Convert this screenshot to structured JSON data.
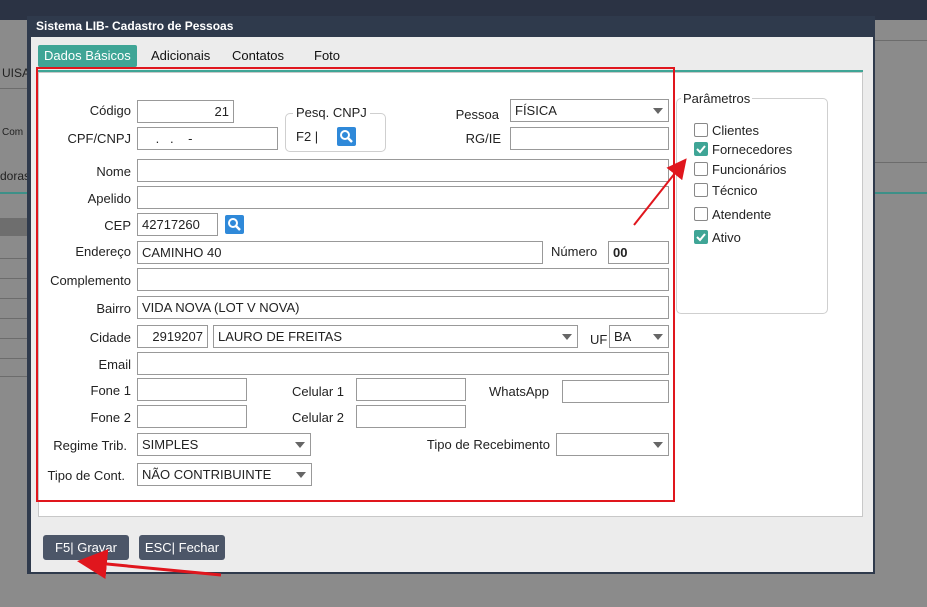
{
  "background": {
    "side_labels": [
      "UISA",
      "Com",
      "doras"
    ]
  },
  "dialog": {
    "title": "Sistema LIB- Cadastro de Pessoas",
    "tabs": [
      {
        "label": "Dados Básicos",
        "active": true
      },
      {
        "label": "Adicionais",
        "active": false
      },
      {
        "label": "Contatos",
        "active": false
      },
      {
        "label": "Foto",
        "active": false
      }
    ]
  },
  "form": {
    "codigo": {
      "label": "Código",
      "value": "21"
    },
    "pesq_cnpj": {
      "label": "Pesq. CNPJ",
      "hint": "F2 |"
    },
    "pessoa": {
      "label": "Pessoa",
      "value": "FÍSICA"
    },
    "cpf_cnpj": {
      "label": "CPF/CNPJ",
      "value": " .   .    -"
    },
    "rg_ie": {
      "label": "RG/IE",
      "value": ""
    },
    "nome": {
      "label": "Nome",
      "value": ""
    },
    "apelido": {
      "label": "Apelido",
      "value": ""
    },
    "cep": {
      "label": "CEP",
      "value": "42717260"
    },
    "endereco": {
      "label": "Endereço",
      "value": "CAMINHO 40"
    },
    "numero": {
      "label": "Número",
      "value": "00"
    },
    "complemento": {
      "label": "Complemento",
      "value": ""
    },
    "bairro": {
      "label": "Bairro",
      "value": "VIDA NOVA (LOT V NOVA)"
    },
    "cidade": {
      "label": "Cidade",
      "code": "2919207",
      "name": "LAURO DE FREITAS"
    },
    "uf": {
      "label": "UF",
      "value": "BA"
    },
    "email": {
      "label": "Email",
      "value": ""
    },
    "fone1": {
      "label": "Fone 1",
      "value": ""
    },
    "celular1": {
      "label": "Celular 1",
      "value": ""
    },
    "whatsapp": {
      "label": "WhatsApp",
      "value": ""
    },
    "fone2": {
      "label": "Fone 2",
      "value": ""
    },
    "celular2": {
      "label": "Celular 2",
      "value": ""
    },
    "regime_trib": {
      "label": "Regime Trib.",
      "value": "SIMPLES"
    },
    "tipo_recebimento": {
      "label": "Tipo de Recebimento",
      "value": ""
    },
    "tipo_cont": {
      "label": "Tipo de Cont.",
      "value": "NÃO CONTRIBUINTE"
    }
  },
  "parametros": {
    "title": "Parâmetros",
    "items": [
      {
        "label": "Clientes",
        "checked": false
      },
      {
        "label": "Fornecedores",
        "checked": true
      },
      {
        "label": "Funcionários",
        "checked": false
      },
      {
        "label": "Técnico",
        "checked": false
      },
      {
        "label": "Atendente",
        "checked": false
      },
      {
        "label": "Ativo",
        "checked": true
      }
    ]
  },
  "buttons": {
    "save": "F5| Gravar",
    "close": "ESC| Fechar"
  },
  "colors": {
    "accent": "#3fa596",
    "dialog_frame": "#2f3a4c",
    "annotation_red": "#e0161d",
    "button": "#4c5668"
  }
}
